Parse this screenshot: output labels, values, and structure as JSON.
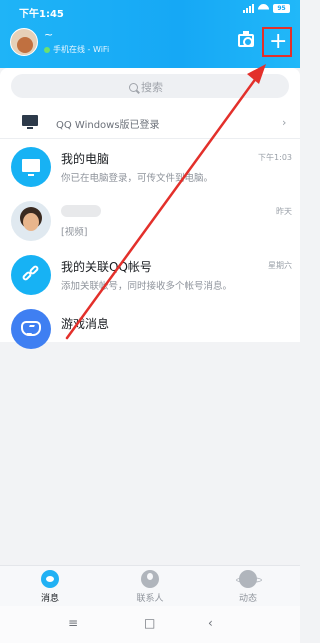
{
  "status": {
    "time": "下午1:45",
    "battery": "95"
  },
  "profile": {
    "nickname": "~",
    "online": "手机在线 - WiFi"
  },
  "search": {
    "placeholder": "搜索"
  },
  "qq_windows": {
    "label": "QQ Windows版已登录"
  },
  "conversations": [
    {
      "title": "我的电脑",
      "subtitle": "你已在电脑登录，可传文件到电脑。",
      "time": "下午1:03"
    },
    {
      "title": "",
      "subtitle": "[视频]",
      "time": "昨天"
    },
    {
      "title": "我的关联QQ帐号",
      "subtitle": "添加关联帐号，同时接收多个帐号消息。",
      "time": "星期六"
    },
    {
      "title": "游戏消息",
      "subtitle": "",
      "time": ""
    }
  ],
  "tabs": [
    {
      "label": "消息"
    },
    {
      "label": "联系人"
    },
    {
      "label": "动态"
    }
  ],
  "colors": {
    "header": "#17a9f5",
    "highlight": "#e3302b",
    "accent": "#17b2f4"
  },
  "icons": [
    "camera-icon",
    "plus-icon",
    "search-icon",
    "computer-icon",
    "link-icon",
    "game-icon",
    "message-icon",
    "contacts-icon",
    "moments-icon"
  ]
}
